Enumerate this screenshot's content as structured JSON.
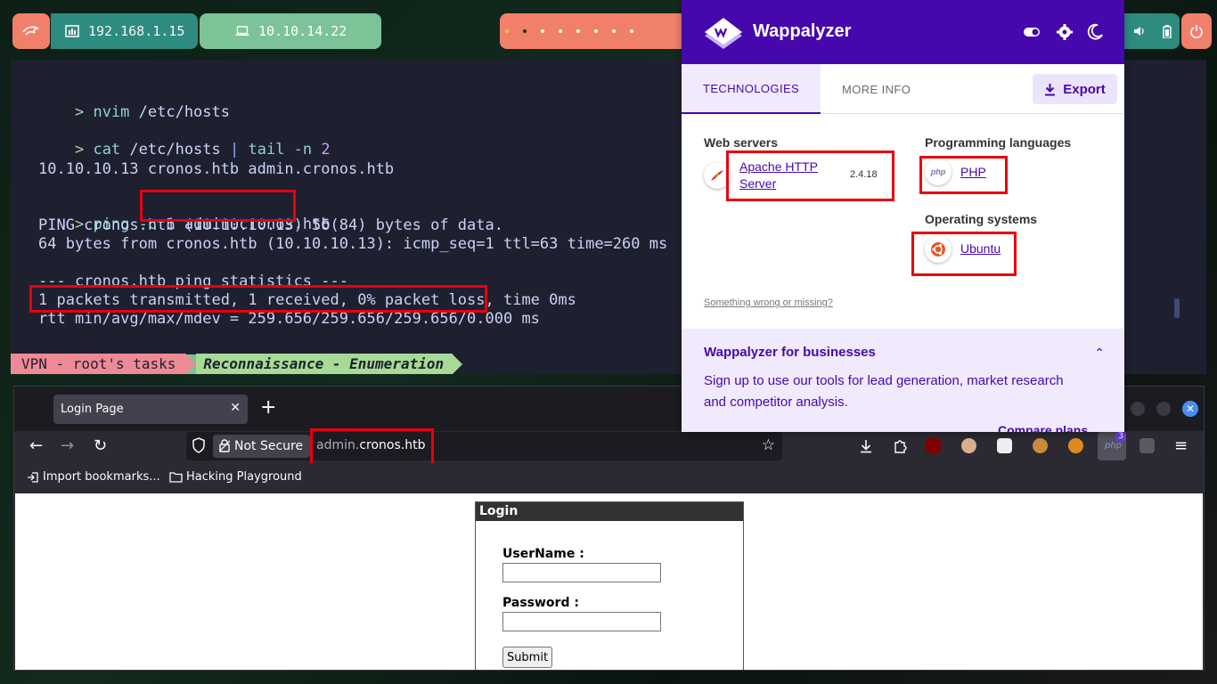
{
  "topbar": {
    "ip_address": "192.168.1.15",
    "vpn_address": "10.10.14.22"
  },
  "terminal": {
    "lines": {
      "l1_prompt": ">",
      "l1_cmd": "nvim",
      "l1_args": " /etc/hosts",
      "l2_prompt": ">",
      "l2_cmd": "cat",
      "l2_args": " /etc/hosts ",
      "l2_pipe": "|",
      "l2_cmd2": " tail",
      "l2_flag": " -n",
      "l2_num": " 2",
      "l3": "10.10.10.13 cronos.htb admin.cronos.htb",
      "l4_prompt": ">",
      "l4_cmd": "ping",
      "l4_flag": " -c",
      "l4_num": " 1",
      "l4_host": " admin.cronos.htb",
      "l5": "PING cronos.htb (10.10.10.13) 56(84) bytes of data.",
      "l6": "64 bytes from cronos.htb (10.10.10.13): icmp_seq=1 ttl=63 time=260 ms",
      "l7": "--- cronos.htb ping statistics ---",
      "l8": "1 packets transmitted, 1 received, 0% packet loss, time 0ms",
      "l9": "rtt min/avg/max/mdev = 259.656/259.656/259.656/0.000 ms"
    },
    "status": {
      "vpn_segment": "VPN - root's tasks",
      "recon_segment": "Reconnaissance - Enumeration"
    }
  },
  "browser": {
    "tab_title": "Login Page",
    "new_tab": "+",
    "not_secure": "Not Secure",
    "url_subdomain": "admin.",
    "url_domain": "cronos.htb",
    "bookmarks": {
      "import": "Import bookmarks...",
      "folder": "Hacking Playground"
    },
    "extension_badge": "3",
    "login": {
      "header": "Login",
      "username_label": "UserName :",
      "password_label": "Password :",
      "submit": "Submit"
    }
  },
  "wappalyzer": {
    "title": "Wappalyzer",
    "tabs": {
      "technologies": "TECHNOLOGIES",
      "more_info": "MORE INFO"
    },
    "export": "Export",
    "categories": {
      "web_servers": {
        "title": "Web servers",
        "tech": "Apache HTTP Server",
        "tech_line1": "Apache HTTP",
        "tech_line2": "Server",
        "version": "2.4.18"
      },
      "programming_languages": {
        "title": "Programming languages",
        "tech": "PHP"
      },
      "operating_systems": {
        "title": "Operating systems",
        "tech": "Ubuntu"
      }
    },
    "feedback": "Something wrong or missing?",
    "business": {
      "title": "Wappalyzer for businesses",
      "text_line1": "Sign up to use our tools for lead generation, market research",
      "text_line2": "and competitor analysis.",
      "link": "Compare plans"
    },
    "colors": {
      "brand": "#4608ad",
      "highlight_box": "#e8000d"
    }
  }
}
